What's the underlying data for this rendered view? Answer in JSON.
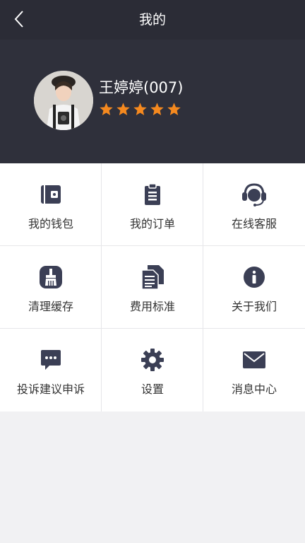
{
  "header": {
    "title": "我的",
    "back_icon": "chevron-left-icon"
  },
  "profile": {
    "name": "王婷婷(007)",
    "rating": 5,
    "rating_max": 5,
    "star_color": "#f5891f"
  },
  "menu": [
    {
      "label": "我的钱包",
      "icon": "wallet-icon"
    },
    {
      "label": "我的订单",
      "icon": "clipboard-icon"
    },
    {
      "label": "在线客服",
      "icon": "headset-icon"
    },
    {
      "label": "清理缓存",
      "icon": "broom-icon"
    },
    {
      "label": "费用标准",
      "icon": "documents-icon"
    },
    {
      "label": "关于我们",
      "icon": "info-icon"
    },
    {
      "label": "投诉建议申诉",
      "icon": "chat-bubble-icon"
    },
    {
      "label": "设置",
      "icon": "gear-icon"
    },
    {
      "label": "消息中心",
      "icon": "envelope-icon"
    }
  ],
  "colors": {
    "header_bg": "#2b2c36",
    "icon": "#3b3f55",
    "page_bg": "#f1f1f3"
  }
}
